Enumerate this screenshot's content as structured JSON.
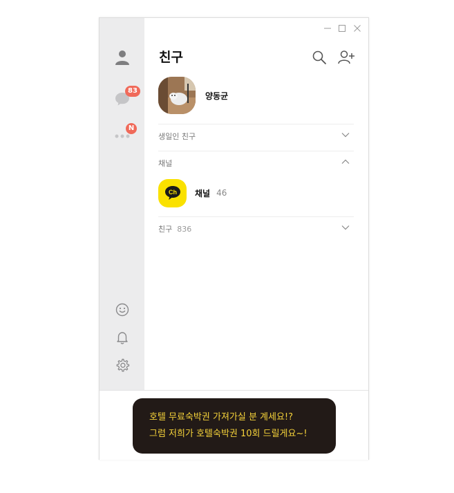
{
  "window": {
    "controls": [
      "minimize-icon",
      "maximize-icon",
      "close-icon"
    ]
  },
  "sidebar": {
    "items": [
      {
        "name": "friends",
        "icon": "person-icon"
      },
      {
        "name": "chats",
        "icon": "chat-bubble-icon",
        "badge": "83"
      },
      {
        "name": "more",
        "icon": "more-dots-icon",
        "badge": "N"
      }
    ],
    "bottom_items": [
      {
        "name": "emoticon",
        "icon": "smiley-icon"
      },
      {
        "name": "notifications",
        "icon": "bell-icon"
      },
      {
        "name": "settings",
        "icon": "gear-icon"
      }
    ]
  },
  "header": {
    "title": "친구",
    "search_icon": "search-icon",
    "add_friend_icon": "add-friend-icon"
  },
  "profile": {
    "name": "양동균"
  },
  "sections": {
    "birthday": {
      "label": "생일인 친구",
      "state": "collapsed"
    },
    "channel": {
      "label": "채널",
      "state": "expanded"
    },
    "friends": {
      "label": "친구",
      "count": "836",
      "state": "collapsed"
    }
  },
  "channel_item": {
    "logo_text": "Ch",
    "name": "채널",
    "count": "46"
  },
  "ad": {
    "line1": "호텔 무료숙박권 가져가실 분 계세요!?",
    "line2": "그럼 저희가 호텔숙박권 10회 드릴게요~!"
  },
  "colors": {
    "sidebar_bg": "#ececed",
    "badge": "#f06a5a",
    "channel_yellow": "#fae100",
    "ad_bg": "#221a17",
    "ad_text": "#f5d23a"
  }
}
